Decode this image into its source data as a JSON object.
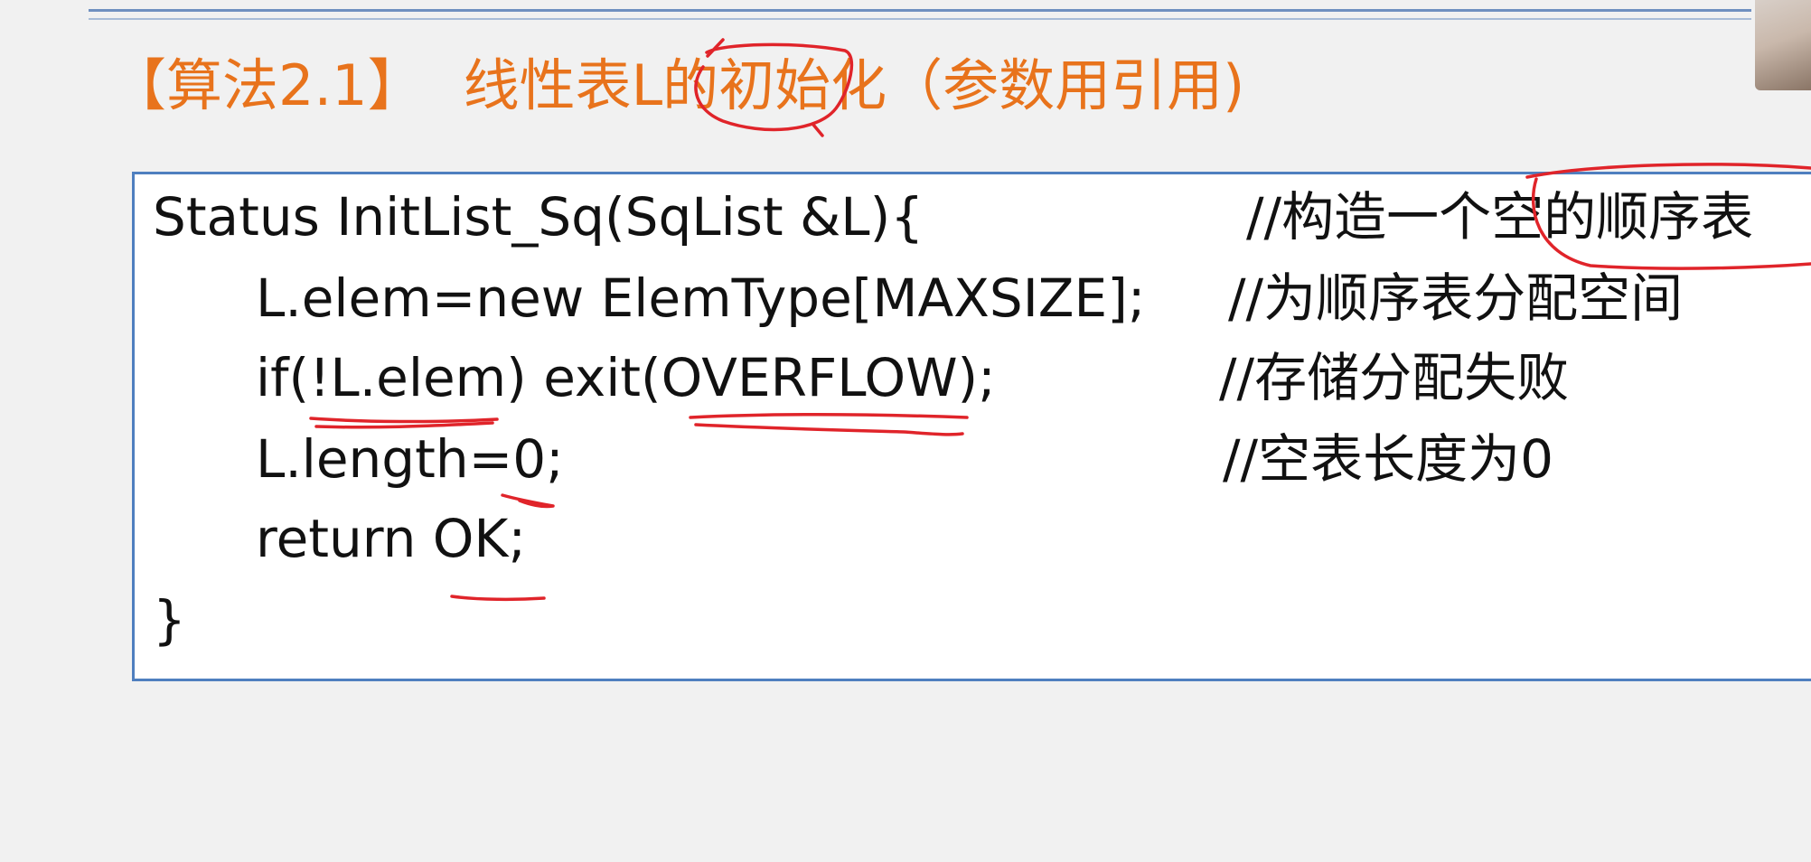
{
  "slide": {
    "title_bracket": "【算法2.1】",
    "title_text": "线性表L的初始化（参数用引用)"
  },
  "code": {
    "line1": "Status InitList_Sq(SqList &L){",
    "line2": "L.elem=new ElemType[MAXSIZE];",
    "line3": "if(!L.elem) exit(OVERFLOW);",
    "line4": "L.length=0;",
    "line5": "return OK;",
    "line6": "}",
    "comment1": "//构造一个空的顺序表",
    "comment2": "//为顺序表分配空间",
    "comment3": "//存储分配失败",
    "comment4": "//空表长度为0"
  },
  "colors": {
    "title": "#e8731c",
    "box_border": "#4f7fbf",
    "annotation_ink": "#e0242a"
  }
}
